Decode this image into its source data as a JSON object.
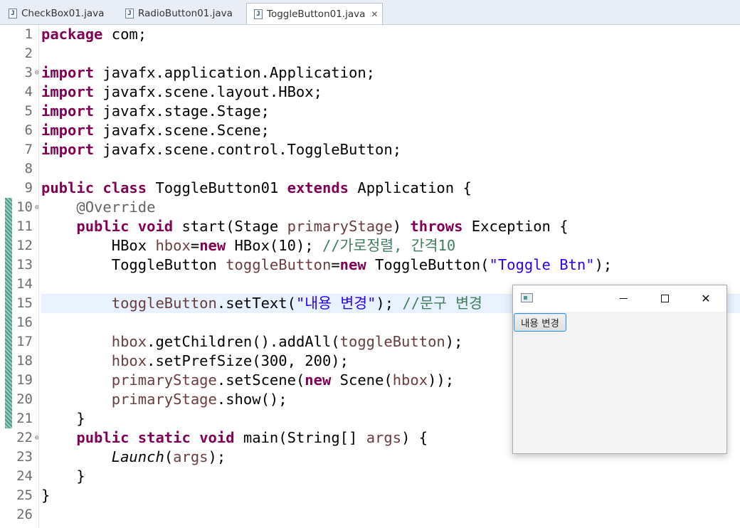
{
  "tabs": [
    {
      "label": "CheckBox01.java",
      "icon": "java-file-icon"
    },
    {
      "label": "RadioButton01.java",
      "icon": "java-file-icon"
    },
    {
      "label": "ToggleButton01.java",
      "icon": "java-file-icon",
      "active": true,
      "close": "✕"
    }
  ],
  "editor": {
    "line_numbers": [
      "1",
      "2",
      "3",
      "4",
      "5",
      "6",
      "7",
      "8",
      "9",
      "10",
      "11",
      "12",
      "13",
      "14",
      "15",
      "16",
      "17",
      "18",
      "19",
      "20",
      "21",
      "22",
      "23",
      "24",
      "25",
      "26"
    ],
    "t": {
      "package": "package",
      "com": " com;",
      "import": "import",
      "imp1": " javafx.application.Application;",
      "imp2": " javafx.scene.layout.HBox;",
      "imp3": " javafx.stage.Stage;",
      "imp4": " javafx.scene.Scene;",
      "imp5": " javafx.scene.control.ToggleButton;",
      "public": "public",
      "class": "class",
      "classname": " ToggleButton01 ",
      "extends": "extends",
      "appbrace": " Application {",
      "override": "@Override",
      "void": "void",
      "start": " start(Stage ",
      "primaryStage": "primaryStage",
      "closeparen": ") ",
      "throws": "throws",
      "exception": " Exception {",
      "hboxType": "HBox ",
      "hbox": "hbox",
      "eq": "=",
      "new": "new",
      "hboxNew": " HBox(10); ",
      "comment1": "//가로정렬, 간격10",
      "tbType": "ToggleButton ",
      "toggleButton": "toggleButton",
      "tbNew": " ToggleButton(",
      "str1": "\"Toggle Btn\"",
      "endparen": ");",
      "setText": ".setText(",
      "str2": "\"내용 변경\"",
      "endparen2": "); ",
      "comment2": "//문구 변경",
      "getChildren": ".getChildren().addAll(",
      "endparenB": ");",
      "setPref": ".setPrefSize(300, 200);",
      "setScene": ".setScene(",
      "scene": " Scene(",
      "endScene": "));",
      "show": ".show();",
      "closebrace": "}",
      "static": "static",
      "main": " main(String[] ",
      "args": "args",
      "mainEnd": ") {",
      "launch": "Launch",
      "open": "(",
      "close2": ");"
    }
  },
  "fx_window": {
    "minimize": "minimize",
    "maximize": "maximize",
    "close": "✕",
    "toggle_label": "내용 변경"
  }
}
